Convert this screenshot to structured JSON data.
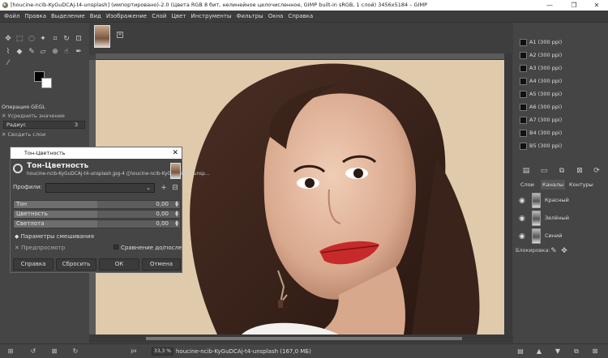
{
  "window": {
    "title": "[houcine-ncib-KyGuDCAj-t4-unsplash] (импортировано)-2.0 (Цвета RGB 8 бит, нелинейное целочисленное, GIMP built-in sRGB, 1 слой) 3456x5184 – GIMP",
    "minimize": "—",
    "maximize": "❐",
    "close": "✕"
  },
  "menu": [
    "Файл",
    "Правка",
    "Выделение",
    "Вид",
    "Изображение",
    "Слой",
    "Цвет",
    "Инструменты",
    "Фильтры",
    "Окна",
    "Справка"
  ],
  "tool_options": {
    "title": "Операция GEGL",
    "option1": "Усреднить значение",
    "radius_label": "Радиус",
    "radius_value": "3",
    "option2": "Сводить слои"
  },
  "brushes": [
    "A1 (300 ppi)",
    "A2 (300 ppi)",
    "A3 (300 ppi)",
    "A4 (300 ppi)",
    "A5 (300 ppi)",
    "A6 (300 ppi)",
    "A7 (300 ppi)",
    "B4 (300 ppi)",
    "B5 (300 ppi)"
  ],
  "dock_tabs": {
    "layers": "Слои",
    "channels": "Каналы",
    "paths": "Контуры"
  },
  "channels": [
    {
      "name": "Красный"
    },
    {
      "name": "Зелёный"
    },
    {
      "name": "Синий"
    }
  ],
  "lock_label": "Блокировка:",
  "dialog": {
    "title": "Тон-Цветность",
    "heading": "Тон-Цветность",
    "subtitle": "houcine-ncib-KyGuDCAj-t4-unsplash.jpg-4 ([houcine-ncib-KyGuDCAj-t4-unsp...",
    "profiles_label": "Профили:",
    "profiles_value": "",
    "sliders": [
      {
        "label": "Тон",
        "value": "0,00"
      },
      {
        "label": "Цветность",
        "value": "0,00"
      },
      {
        "label": "Светлота",
        "value": "0,00"
      }
    ],
    "blend_options": "Параметры смешивания",
    "preview": "Предпросмотр",
    "compare": "Сравнение до/после",
    "buttons": {
      "help": "Справка",
      "reset": "Сбросить",
      "ok": "ОК",
      "cancel": "Отмена"
    }
  },
  "status": {
    "unit": "px",
    "zoom": "33,3 %",
    "file": "houcine-ncib-KyGuDCAj-t4-unsplash (167,0 МБ)"
  },
  "colors": {
    "accent": "#e24a44",
    "chrome": "#454545",
    "canvas_bg": "#e0ccae"
  }
}
